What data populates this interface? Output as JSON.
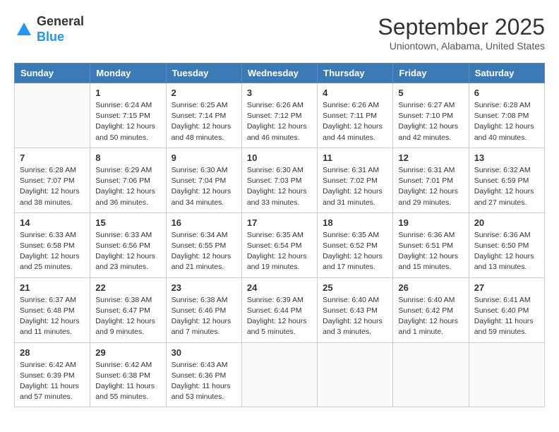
{
  "header": {
    "logo_general": "General",
    "logo_blue": "Blue",
    "month_title": "September 2025",
    "subtitle": "Uniontown, Alabama, United States"
  },
  "weekdays": [
    "Sunday",
    "Monday",
    "Tuesday",
    "Wednesday",
    "Thursday",
    "Friday",
    "Saturday"
  ],
  "weeks": [
    [
      {
        "day": "",
        "detail": ""
      },
      {
        "day": "1",
        "detail": "Sunrise: 6:24 AM\nSunset: 7:15 PM\nDaylight: 12 hours\nand 50 minutes."
      },
      {
        "day": "2",
        "detail": "Sunrise: 6:25 AM\nSunset: 7:14 PM\nDaylight: 12 hours\nand 48 minutes."
      },
      {
        "day": "3",
        "detail": "Sunrise: 6:26 AM\nSunset: 7:12 PM\nDaylight: 12 hours\nand 46 minutes."
      },
      {
        "day": "4",
        "detail": "Sunrise: 6:26 AM\nSunset: 7:11 PM\nDaylight: 12 hours\nand 44 minutes."
      },
      {
        "day": "5",
        "detail": "Sunrise: 6:27 AM\nSunset: 7:10 PM\nDaylight: 12 hours\nand 42 minutes."
      },
      {
        "day": "6",
        "detail": "Sunrise: 6:28 AM\nSunset: 7:08 PM\nDaylight: 12 hours\nand 40 minutes."
      }
    ],
    [
      {
        "day": "7",
        "detail": "Sunrise: 6:28 AM\nSunset: 7:07 PM\nDaylight: 12 hours\nand 38 minutes."
      },
      {
        "day": "8",
        "detail": "Sunrise: 6:29 AM\nSunset: 7:06 PM\nDaylight: 12 hours\nand 36 minutes."
      },
      {
        "day": "9",
        "detail": "Sunrise: 6:30 AM\nSunset: 7:04 PM\nDaylight: 12 hours\nand 34 minutes."
      },
      {
        "day": "10",
        "detail": "Sunrise: 6:30 AM\nSunset: 7:03 PM\nDaylight: 12 hours\nand 33 minutes."
      },
      {
        "day": "11",
        "detail": "Sunrise: 6:31 AM\nSunset: 7:02 PM\nDaylight: 12 hours\nand 31 minutes."
      },
      {
        "day": "12",
        "detail": "Sunrise: 6:31 AM\nSunset: 7:01 PM\nDaylight: 12 hours\nand 29 minutes."
      },
      {
        "day": "13",
        "detail": "Sunrise: 6:32 AM\nSunset: 6:59 PM\nDaylight: 12 hours\nand 27 minutes."
      }
    ],
    [
      {
        "day": "14",
        "detail": "Sunrise: 6:33 AM\nSunset: 6:58 PM\nDaylight: 12 hours\nand 25 minutes."
      },
      {
        "day": "15",
        "detail": "Sunrise: 6:33 AM\nSunset: 6:56 PM\nDaylight: 12 hours\nand 23 minutes."
      },
      {
        "day": "16",
        "detail": "Sunrise: 6:34 AM\nSunset: 6:55 PM\nDaylight: 12 hours\nand 21 minutes."
      },
      {
        "day": "17",
        "detail": "Sunrise: 6:35 AM\nSunset: 6:54 PM\nDaylight: 12 hours\nand 19 minutes."
      },
      {
        "day": "18",
        "detail": "Sunrise: 6:35 AM\nSunset: 6:52 PM\nDaylight: 12 hours\nand 17 minutes."
      },
      {
        "day": "19",
        "detail": "Sunrise: 6:36 AM\nSunset: 6:51 PM\nDaylight: 12 hours\nand 15 minutes."
      },
      {
        "day": "20",
        "detail": "Sunrise: 6:36 AM\nSunset: 6:50 PM\nDaylight: 12 hours\nand 13 minutes."
      }
    ],
    [
      {
        "day": "21",
        "detail": "Sunrise: 6:37 AM\nSunset: 6:48 PM\nDaylight: 12 hours\nand 11 minutes."
      },
      {
        "day": "22",
        "detail": "Sunrise: 6:38 AM\nSunset: 6:47 PM\nDaylight: 12 hours\nand 9 minutes."
      },
      {
        "day": "23",
        "detail": "Sunrise: 6:38 AM\nSunset: 6:46 PM\nDaylight: 12 hours\nand 7 minutes."
      },
      {
        "day": "24",
        "detail": "Sunrise: 6:39 AM\nSunset: 6:44 PM\nDaylight: 12 hours\nand 5 minutes."
      },
      {
        "day": "25",
        "detail": "Sunrise: 6:40 AM\nSunset: 6:43 PM\nDaylight: 12 hours\nand 3 minutes."
      },
      {
        "day": "26",
        "detail": "Sunrise: 6:40 AM\nSunset: 6:42 PM\nDaylight: 12 hours\nand 1 minute."
      },
      {
        "day": "27",
        "detail": "Sunrise: 6:41 AM\nSunset: 6:40 PM\nDaylight: 11 hours\nand 59 minutes."
      }
    ],
    [
      {
        "day": "28",
        "detail": "Sunrise: 6:42 AM\nSunset: 6:39 PM\nDaylight: 11 hours\nand 57 minutes."
      },
      {
        "day": "29",
        "detail": "Sunrise: 6:42 AM\nSunset: 6:38 PM\nDaylight: 11 hours\nand 55 minutes."
      },
      {
        "day": "30",
        "detail": "Sunrise: 6:43 AM\nSunset: 6:36 PM\nDaylight: 11 hours\nand 53 minutes."
      },
      {
        "day": "",
        "detail": ""
      },
      {
        "day": "",
        "detail": ""
      },
      {
        "day": "",
        "detail": ""
      },
      {
        "day": "",
        "detail": ""
      }
    ]
  ]
}
